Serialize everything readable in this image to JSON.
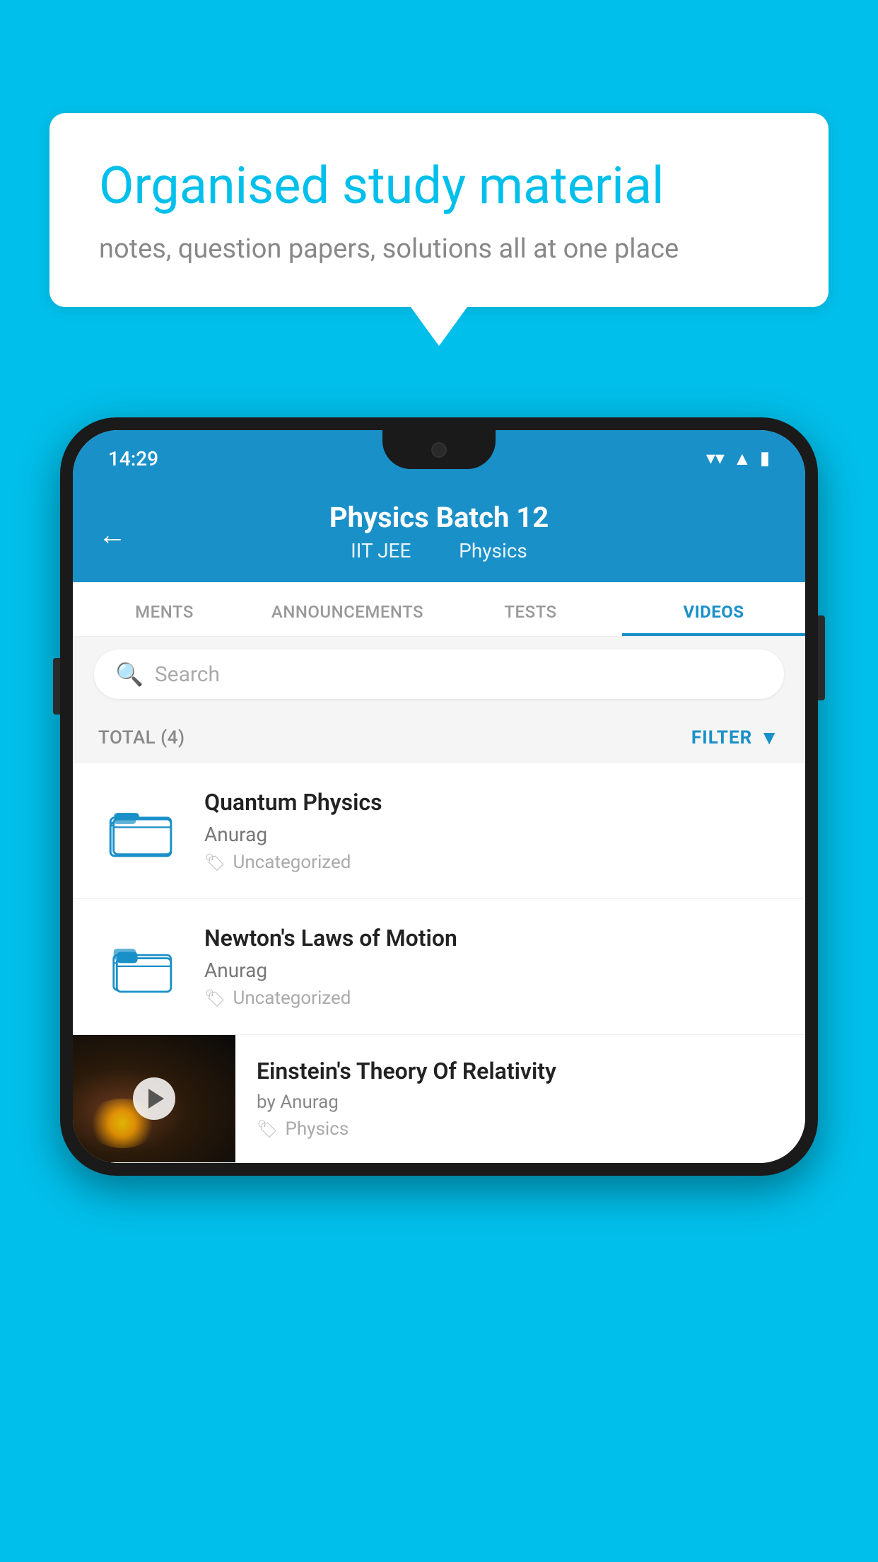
{
  "background_color": "#00BFEA",
  "speech_bubble": {
    "title": "Organised study material",
    "subtitle": "notes, question papers, solutions all at one place"
  },
  "status_bar": {
    "time": "14:29",
    "wifi": "▼",
    "signal": "▲",
    "battery": "▮"
  },
  "app_header": {
    "title": "Physics Batch 12",
    "subtitle_part1": "IIT JEE",
    "subtitle_part2": "Physics",
    "back_label": "←"
  },
  "tabs": [
    {
      "label": "MENTS",
      "active": false
    },
    {
      "label": "ANNOUNCEMENTS",
      "active": false
    },
    {
      "label": "TESTS",
      "active": false
    },
    {
      "label": "VIDEOS",
      "active": true
    }
  ],
  "search": {
    "placeholder": "Search"
  },
  "filter_row": {
    "total_label": "TOTAL (4)",
    "filter_label": "FILTER"
  },
  "videos": [
    {
      "id": 1,
      "title": "Quantum Physics",
      "author": "Anurag",
      "tag": "Uncategorized",
      "has_thumbnail": false
    },
    {
      "id": 2,
      "title": "Newton's Laws of Motion",
      "author": "Anurag",
      "tag": "Uncategorized",
      "has_thumbnail": false
    },
    {
      "id": 3,
      "title": "Einstein's Theory Of Relativity",
      "author": "by Anurag",
      "tag": "Physics",
      "has_thumbnail": true
    }
  ]
}
